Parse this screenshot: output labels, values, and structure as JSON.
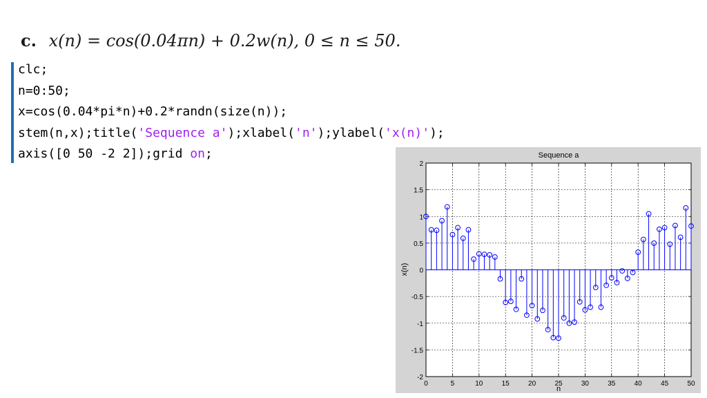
{
  "heading": {
    "label": "c.",
    "equation": "x(n) = cos(0.04πn) + 0.2w(n),    0 ≤ n ≤ 50."
  },
  "code": {
    "lines": [
      [
        {
          "t": "clc;",
          "c": "plain"
        }
      ],
      [
        {
          "t": "n=0:50;",
          "c": "plain"
        }
      ],
      [
        {
          "t": "x=cos(0.04*pi*n)+0.2*randn(size(n));",
          "c": "plain"
        }
      ],
      [
        {
          "t": "stem(n,x);title(",
          "c": "plain"
        },
        {
          "t": "'Sequence a'",
          "c": "str"
        },
        {
          "t": ");xlabel(",
          "c": "plain"
        },
        {
          "t": "'n'",
          "c": "str"
        },
        {
          "t": ");ylabel(",
          "c": "plain"
        },
        {
          "t": "'x(n)'",
          "c": "str"
        },
        {
          "t": ");",
          "c": "plain"
        }
      ],
      [
        {
          "t": "axis([0 50 -2 2]);grid ",
          "c": "plain"
        },
        {
          "t": "on",
          "c": "str"
        },
        {
          "t": ";",
          "c": "plain"
        }
      ]
    ]
  },
  "chart_data": {
    "type": "stem",
    "title": "Sequence a",
    "xlabel": "n",
    "ylabel": "x(n)",
    "xlim": [
      0,
      50
    ],
    "ylim": [
      -2,
      2
    ],
    "xticks": [
      0,
      5,
      10,
      15,
      20,
      25,
      30,
      35,
      40,
      45,
      50
    ],
    "yticks": [
      -2,
      -1.5,
      -1,
      -0.5,
      0,
      0.5,
      1,
      1.5,
      2
    ],
    "grid": true,
    "color": "#0000ff",
    "x": [
      0,
      1,
      2,
      3,
      4,
      5,
      6,
      7,
      8,
      9,
      10,
      11,
      12,
      13,
      14,
      15,
      16,
      17,
      18,
      19,
      20,
      21,
      22,
      23,
      24,
      25,
      26,
      27,
      28,
      29,
      30,
      31,
      32,
      33,
      34,
      35,
      36,
      37,
      38,
      39,
      40,
      41,
      42,
      43,
      44,
      45,
      46,
      47,
      48,
      49,
      50
    ],
    "y": [
      1.0,
      0.75,
      0.74,
      0.92,
      1.18,
      0.66,
      0.79,
      0.59,
      0.75,
      0.2,
      0.3,
      0.29,
      0.28,
      0.24,
      -0.17,
      -0.61,
      -0.59,
      -0.74,
      -0.17,
      -0.85,
      -0.67,
      -0.92,
      -0.76,
      -1.12,
      -1.27,
      -1.28,
      -0.9,
      -1.0,
      -0.98,
      -0.6,
      -0.75,
      -0.7,
      -0.33,
      -0.7,
      -0.29,
      -0.15,
      -0.24,
      -0.02,
      -0.16,
      -0.05,
      0.33,
      0.57,
      1.05,
      0.5,
      0.76,
      0.79,
      0.48,
      0.83,
      0.61,
      1.16,
      0.82
    ]
  }
}
